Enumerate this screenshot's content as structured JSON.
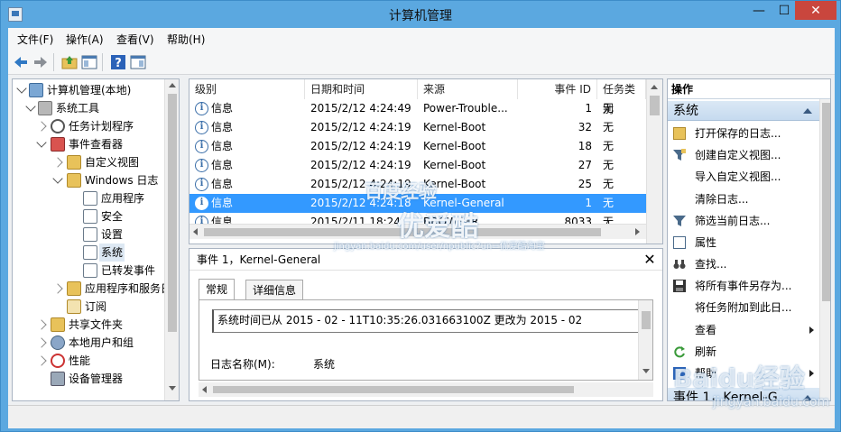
{
  "window": {
    "title": "计算机管理",
    "minimize": "—",
    "maximize": "☐",
    "close": "✕"
  },
  "menubar": {
    "items": [
      "文件(F)",
      "操作(A)",
      "查看(V)",
      "帮助(H)"
    ]
  },
  "toolbar": {
    "icons": [
      "back-arrow-icon",
      "forward-arrow-icon",
      "folder-up-icon",
      "show-hide-console-tree-icon",
      "help-icon",
      "properties-pane-icon"
    ]
  },
  "tree": {
    "items": [
      {
        "label": "计算机管理(本地)",
        "icon": "computer-icon"
      },
      {
        "label": "系统工具",
        "icon": "tools-icon"
      },
      {
        "label": "任务计划程序",
        "icon": "clock-icon"
      },
      {
        "label": "事件查看器",
        "icon": "event-viewer-icon"
      },
      {
        "label": "自定义视图",
        "icon": "folder-icon"
      },
      {
        "label": "Windows 日志",
        "icon": "folder-icon"
      },
      {
        "label": "应用程序",
        "icon": "log-icon"
      },
      {
        "label": "安全",
        "icon": "log-icon"
      },
      {
        "label": "设置",
        "icon": "log-icon"
      },
      {
        "label": "系统",
        "icon": "log-icon"
      },
      {
        "label": "已转发事件",
        "icon": "log-icon"
      },
      {
        "label": "应用程序和服务日",
        "icon": "folder-icon"
      },
      {
        "label": "订阅",
        "icon": "subscription-icon"
      },
      {
        "label": "共享文件夹",
        "icon": "shared-folder-icon"
      },
      {
        "label": "本地用户和组",
        "icon": "users-icon"
      },
      {
        "label": "性能",
        "icon": "performance-icon"
      },
      {
        "label": "设备管理器",
        "icon": "device-manager-icon"
      }
    ]
  },
  "events": {
    "columns": [
      "级别",
      "日期和时间",
      "来源",
      "事件 ID",
      "任务类别"
    ],
    "rows": [
      {
        "level": "信息",
        "datetime": "2015/2/12 4:24:49",
        "source": "Power-Trouble...",
        "id": "1",
        "category": "无"
      },
      {
        "level": "信息",
        "datetime": "2015/2/12 4:24:19",
        "source": "Kernel-Boot",
        "id": "32",
        "category": "无"
      },
      {
        "level": "信息",
        "datetime": "2015/2/12 4:24:19",
        "source": "Kernel-Boot",
        "id": "18",
        "category": "无"
      },
      {
        "level": "信息",
        "datetime": "2015/2/12 4:24:19",
        "source": "Kernel-Boot",
        "id": "27",
        "category": "无"
      },
      {
        "level": "信息",
        "datetime": "2015/2/12 4:24:19",
        "source": "Kernel-Boot",
        "id": "25",
        "category": "无"
      },
      {
        "level": "信息",
        "datetime": "2015/2/12 4:24:18",
        "source": "Kernel-General",
        "id": "1",
        "category": "无"
      },
      {
        "level": "信息",
        "datetime": "2015/2/11 18:24",
        "source": "BROWSER",
        "id": "8033",
        "category": "无"
      }
    ],
    "selected_index": 5
  },
  "detail": {
    "title": "事件 1，Kernel-General",
    "close": "✕",
    "tabs": [
      "常规",
      "详细信息"
    ],
    "active_tab": "常规",
    "message": "系统时间已从    2015  -  02  -  11T10:35:26.031663100Z 更改为    2015  -  02",
    "log_name_label": "日志名称(M):",
    "log_name_value": "系统"
  },
  "actions": {
    "header": "操作",
    "section1": "系统",
    "items": [
      {
        "label": "打开保存的日志...",
        "icon": "open-folder-icon",
        "submenu": false
      },
      {
        "label": "创建自定义视图...",
        "icon": "filter-icon",
        "submenu": false
      },
      {
        "label": "导入自定义视图...",
        "icon": "",
        "submenu": false
      },
      {
        "label": "清除日志...",
        "icon": "",
        "submenu": false
      },
      {
        "label": "筛选当前日志...",
        "icon": "filter-icon",
        "submenu": false
      },
      {
        "label": "属性",
        "icon": "properties-icon",
        "submenu": false
      },
      {
        "label": "查找...",
        "icon": "binoculars-icon",
        "submenu": false
      },
      {
        "label": "将所有事件另存为...",
        "icon": "save-icon",
        "submenu": false
      },
      {
        "label": "将任务附加到此日...",
        "icon": "",
        "submenu": false
      },
      {
        "label": "查看",
        "icon": "",
        "submenu": true
      },
      {
        "label": "刷新",
        "icon": "refresh-icon",
        "submenu": false
      },
      {
        "label": "帮助",
        "icon": "help-icon",
        "submenu": true
      }
    ],
    "section2": "事件 1，Kernel-G"
  },
  "watermarks": {
    "w1": "百度经验",
    "w2": "优爱酷",
    "w3": "jingyan.baidu.com/user/npublic?un=优爱酷淘宝",
    "w4": "Baidu经验",
    "w5": "jingyan.baidu.com"
  },
  "colors": {
    "titlebar": "#5ba8e0",
    "selection": "#3399ff",
    "close_button": "#c9463d"
  }
}
